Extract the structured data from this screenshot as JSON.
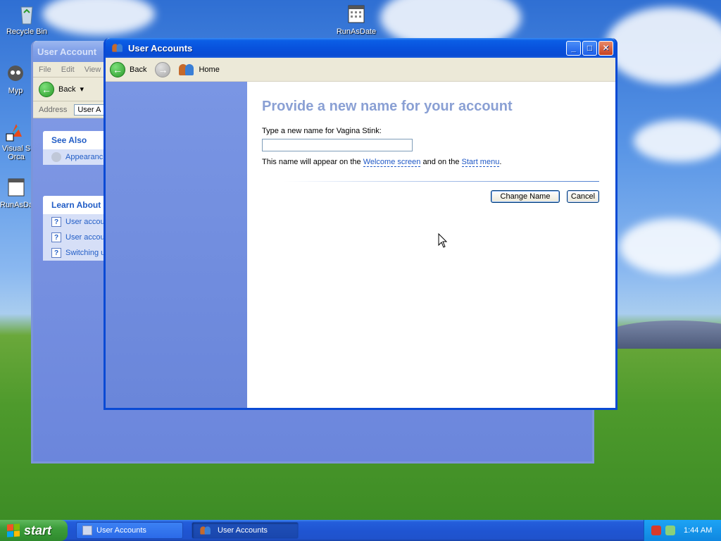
{
  "desktop": {
    "icons": [
      {
        "label": "Recycle Bin"
      },
      {
        "label": "RunAsDate"
      },
      {
        "label": "Myp"
      },
      {
        "label": "Visual S\nOrca"
      },
      {
        "label": "RunAsDa"
      }
    ]
  },
  "back_window": {
    "title": "User Account",
    "menu": [
      "File",
      "Edit",
      "View"
    ],
    "back_label": "Back",
    "address_label": "Address",
    "address_value": "User A",
    "see_also": {
      "header": "See Also",
      "items": [
        "Appearanc"
      ]
    },
    "learn_about": {
      "header": "Learn About",
      "items": [
        "User accou",
        "User accou",
        "Switching u"
      ]
    }
  },
  "front_window": {
    "title": "User Accounts",
    "nav": {
      "back": "Back",
      "home": "Home"
    },
    "heading": "Provide a new name for your account",
    "prompt": "Type a new name for Vagina Stink:",
    "input_value": "",
    "info": {
      "prefix": "This name will appear on the ",
      "link1": "Welcome screen",
      "middle": " and on the ",
      "link2": "Start menu",
      "suffix": "."
    },
    "buttons": {
      "change_name": "Change Name",
      "cancel": "Cancel"
    }
  },
  "taskbar": {
    "start": "start",
    "items": [
      "User Accounts",
      "User Accounts"
    ],
    "clock": "1:44 AM"
  },
  "colors": {
    "heading": "#8aa0d4",
    "link": "#1f58c6",
    "xp_blue": "#0a4ad4"
  }
}
